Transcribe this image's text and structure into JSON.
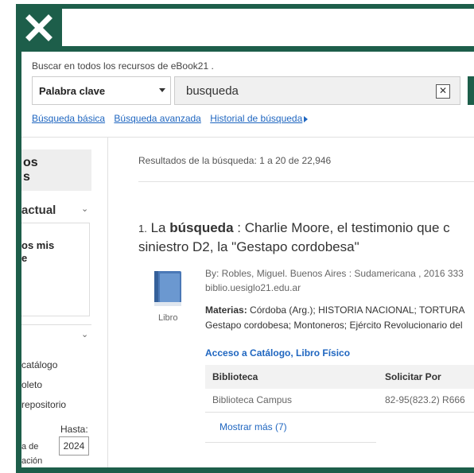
{
  "search": {
    "hint": "Buscar en todos los recursos de eBook21 .",
    "select_value": "Palabra clave",
    "query_value": "busqueda",
    "clear_label": "✕"
  },
  "links": {
    "basic": "Búsqueda básica",
    "advanced": "Búsqueda avanzada",
    "history": "Historial de búsqueda"
  },
  "sidebar": {
    "box1_text": "os\ns",
    "actual": "actual",
    "box2_text": "os mis\ne",
    "items": [
      "catálogo",
      "oleto",
      "repositorio"
    ],
    "hasta_label": "Hasta:",
    "hasta_value": "2024",
    "small1": "a de",
    "small2": "ación"
  },
  "results": {
    "count_text": "Resultados de la búsqueda: 1 a 20 de 22,946",
    "item": {
      "number": "1.",
      "title_pre": "La",
      "title_bold": "búsqueda",
      "title_post": ": Charlie Moore, el testimonio que c",
      "title_line2": "siniestro D2, la \"Gestapo cordobesa\"",
      "format_label": "Libro",
      "by_line1": "By: Robles, Miguel. Buenos Aires : Sudamericana , 2016 333",
      "by_line2": "biblio.uesiglo21.edu.ar",
      "materias_label": "Materias:",
      "materias_line1": "Córdoba (Arg.); HISTORIA NACIONAL; TORTURA",
      "materias_line2": "Gestapo cordobesa; Montoneros; Ejército Revolucionario del",
      "access_label": "Acceso a Catálogo, Libro Físico",
      "table": {
        "col1": "Biblioteca",
        "col2": "Solicitar Por",
        "row1_col1": "Biblioteca Campus",
        "row1_col2": "82-95(823.2) R666"
      },
      "show_more": "Mostrar más (7)"
    }
  },
  "colors": {
    "brand_green": "#1d5e4a",
    "link_blue": "#1f66c0"
  },
  "icons": {
    "logo": "close-x-logo-icon",
    "book": "book-icon",
    "select_caret": "caret-down-icon",
    "history_arrow": "triangle-right-icon"
  }
}
